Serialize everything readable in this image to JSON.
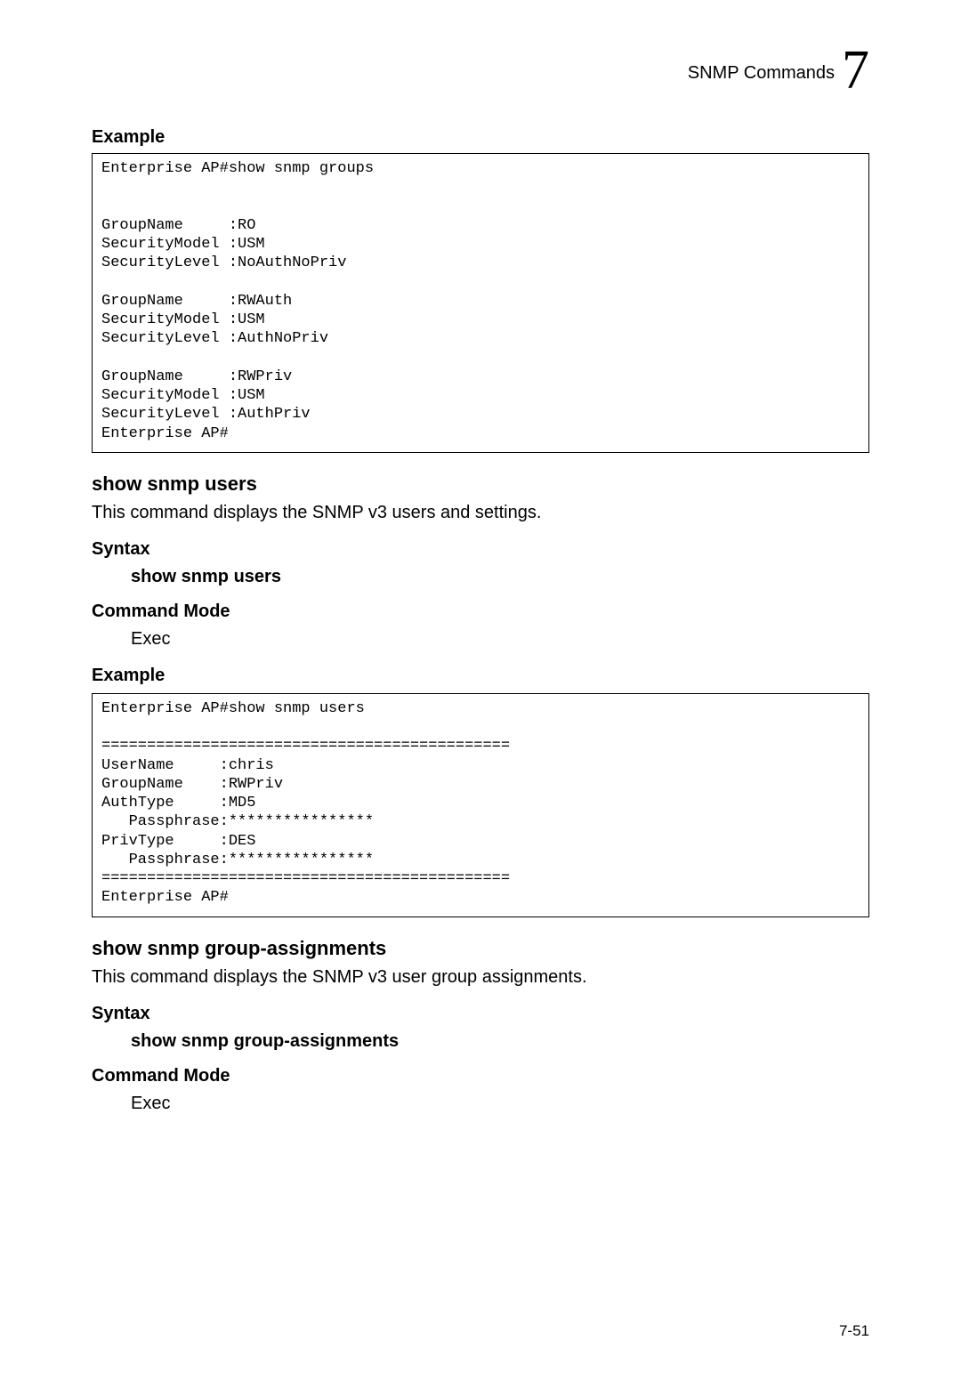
{
  "header": {
    "section_title": "SNMP Commands",
    "chapter_number": "7"
  },
  "example_heading_1": "Example",
  "code_block_1": "Enterprise AP#show snmp groups\n\n\nGroupName     :RO\nSecurityModel :USM\nSecurityLevel :NoAuthNoPriv\n\nGroupName     :RWAuth\nSecurityModel :USM\nSecurityLevel :AuthNoPriv\n\nGroupName     :RWPriv\nSecurityModel :USM\nSecurityLevel :AuthPriv\nEnterprise AP#",
  "command_1": {
    "title": "show snmp users",
    "description": "This command displays the SNMP v3 users and settings.",
    "syntax_heading": "Syntax",
    "syntax_value": "show snmp users",
    "mode_heading": "Command Mode",
    "mode_value": "Exec",
    "example_heading": "Example",
    "code": "Enterprise AP#show snmp users\n\n=============================================\nUserName     :chris\nGroupName    :RWPriv\nAuthType     :MD5\n   Passphrase:****************\nPrivType     :DES\n   Passphrase:****************\n=============================================\nEnterprise AP#"
  },
  "command_2": {
    "title": "show snmp group-assignments",
    "description": "This command displays the SNMP v3 user group assignments.",
    "syntax_heading": "Syntax",
    "syntax_value": "show snmp group-assignments",
    "mode_heading": "Command Mode",
    "mode_value": "Exec"
  },
  "page_number": "7-51"
}
